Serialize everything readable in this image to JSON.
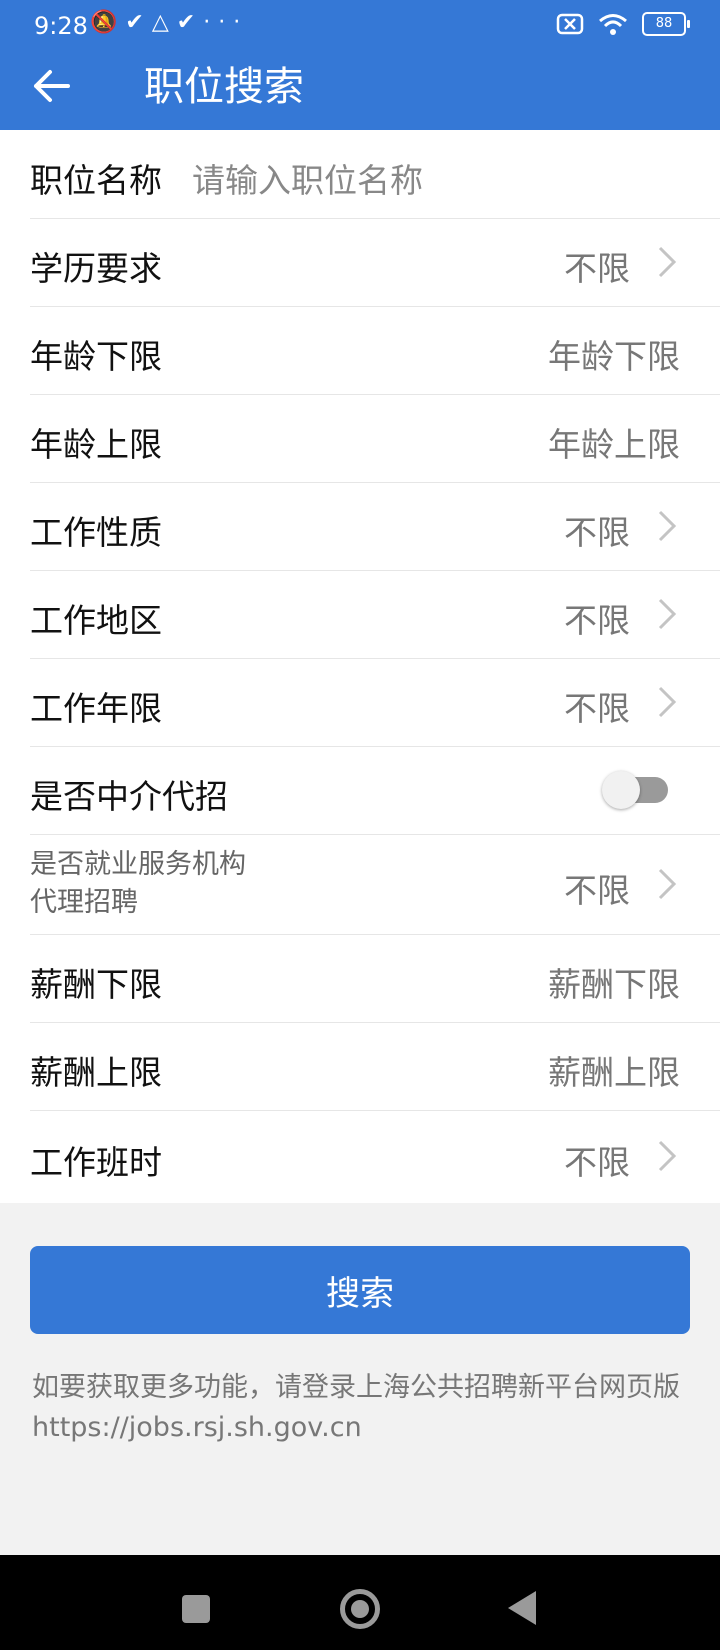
{
  "status": {
    "time": "9:28",
    "left_icons": [
      "mute-bell-icon",
      "check-icon",
      "drive-icon",
      "check-icon",
      "more-dots-icon"
    ],
    "battery": "88"
  },
  "header": {
    "title": "职位搜索"
  },
  "colors": {
    "brand": "#3578d6",
    "background": "#f2f2f2"
  },
  "form": {
    "job_name": {
      "label": "职位名称",
      "placeholder": "请输入职位名称"
    },
    "education": {
      "label": "学历要求",
      "value": "不限"
    },
    "age_min": {
      "label": "年龄下限",
      "placeholder": "年龄下限"
    },
    "age_max": {
      "label": "年龄上限",
      "placeholder": "年龄上限"
    },
    "job_nature": {
      "label": "工作性质",
      "value": "不限"
    },
    "work_area": {
      "label": "工作地区",
      "value": "不限"
    },
    "work_years": {
      "label": "工作年限",
      "value": "不限"
    },
    "agency": {
      "label": "是否中介代招",
      "enabled": false
    },
    "service_agency": {
      "label_line1": "是否就业服务机构",
      "label_line2": "代理招聘",
      "value": "不限"
    },
    "salary_min": {
      "label": "薪酬下限",
      "placeholder": "薪酬下限"
    },
    "salary_max": {
      "label": "薪酬上限",
      "placeholder": "薪酬上限"
    },
    "shift": {
      "label": "工作班时",
      "value": "不限"
    }
  },
  "search_button": {
    "label": "搜索"
  },
  "note": {
    "text": "如要获取更多功能，请登录上海公共招聘新平台网页版",
    "url": "https://jobs.rsj.sh.gov.cn"
  }
}
